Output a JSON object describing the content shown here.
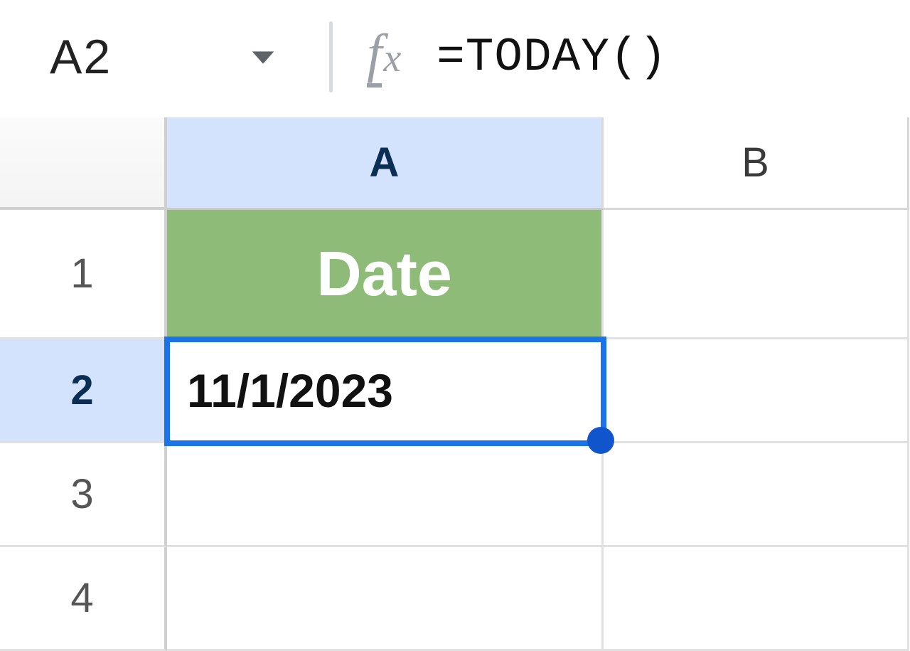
{
  "formula_bar": {
    "cell_ref": "A2",
    "formula": "=TODAY()"
  },
  "columns": [
    "A",
    "B"
  ],
  "rows": [
    "1",
    "2",
    "3",
    "4"
  ],
  "active": {
    "col": "A",
    "row": "2"
  },
  "cells": {
    "A1": "Date",
    "A2": "11/1/2023"
  }
}
